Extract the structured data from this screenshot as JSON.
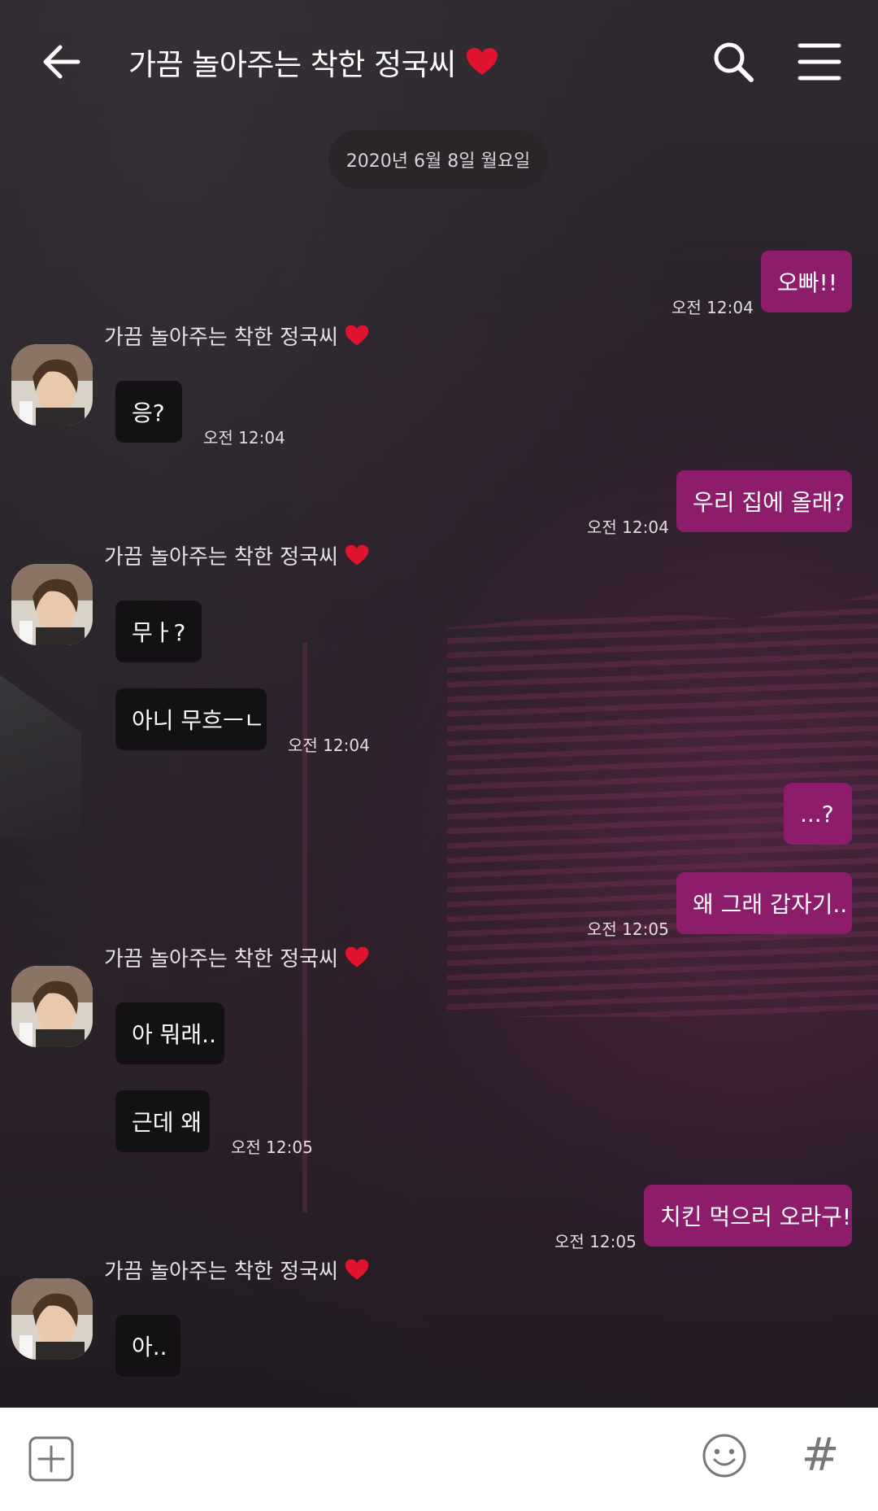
{
  "header": {
    "title": "가끔 놀아주는 착한 정국씨",
    "back_icon": "back-arrow-icon",
    "search_icon": "search-icon",
    "menu_icon": "menu-icon"
  },
  "date_divider": "2020년 6월 8일 월요일",
  "contact_name": "가끔 놀아주는 착한 정국씨",
  "colors": {
    "my_bubble": "#8d1d6b",
    "their_bubble": "#141114",
    "heart": "#e0142f"
  },
  "messages": [
    {
      "from": "me",
      "text": "오빠!!",
      "time": "오전 12:04"
    },
    {
      "from": "them",
      "text": "응?",
      "time": "오전 12:04"
    },
    {
      "from": "me",
      "text": "우리 집에 올래?",
      "time": "오전 12:04"
    },
    {
      "from": "them",
      "text": "무ㅏ?",
      "time": ""
    },
    {
      "from": "them",
      "text": "아니 무흐ㅡㄴ",
      "time": "오전 12:04"
    },
    {
      "from": "me",
      "text": "...?",
      "time": ""
    },
    {
      "from": "me",
      "text": "왜 그래 갑자기..",
      "time": "오전 12:05"
    },
    {
      "from": "them",
      "text": "아 뭐래..",
      "time": ""
    },
    {
      "from": "them",
      "text": "근데 왜",
      "time": "오전 12:05"
    },
    {
      "from": "me",
      "text": "치킨 먹으러 오라구!",
      "time": "오전 12:05"
    },
    {
      "from": "them",
      "text": "아..",
      "time": ""
    }
  ],
  "bottom_bar": {
    "plus_icon": "plus-square-icon",
    "emoji_icon": "emoji-icon",
    "hash_label": "#"
  }
}
